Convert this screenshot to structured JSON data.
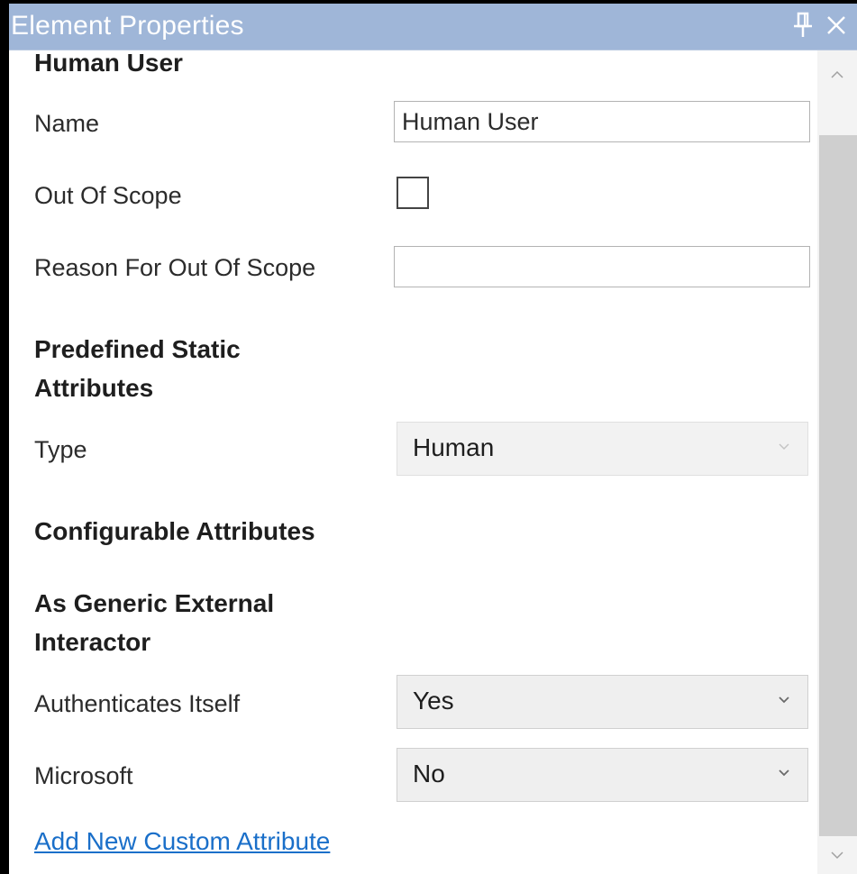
{
  "window": {
    "title": "Element Properties",
    "pin_glyph": "╤",
    "close_glyph": "✕"
  },
  "element": {
    "heading": "Human User"
  },
  "fields": {
    "name": {
      "label": "Name",
      "value": "Human User"
    },
    "out_of_scope": {
      "label": "Out Of Scope",
      "checked": false
    },
    "reason": {
      "label": "Reason For Out Of Scope",
      "value": ""
    }
  },
  "predefined": {
    "heading_line1": "Predefined Static",
    "heading_line2": "Attributes",
    "type": {
      "label": "Type",
      "value": "Human"
    }
  },
  "configurable": {
    "heading": "Configurable Attributes"
  },
  "generic_external": {
    "heading_line1": "As Generic External",
    "heading_line2": "Interactor",
    "authenticates": {
      "label": "Authenticates Itself",
      "value": "Yes"
    },
    "microsoft": {
      "label": "Microsoft",
      "value": "No"
    }
  },
  "add_link": "Add New Custom Attribute",
  "colors": {
    "titlebar": "#9fb6d8",
    "link": "#1a6fc9",
    "select_bg": "#efefef"
  },
  "icons": [
    "pin-icon",
    "close-icon",
    "chevron-down-icon",
    "scroll-up-icon",
    "scroll-down-icon"
  ]
}
